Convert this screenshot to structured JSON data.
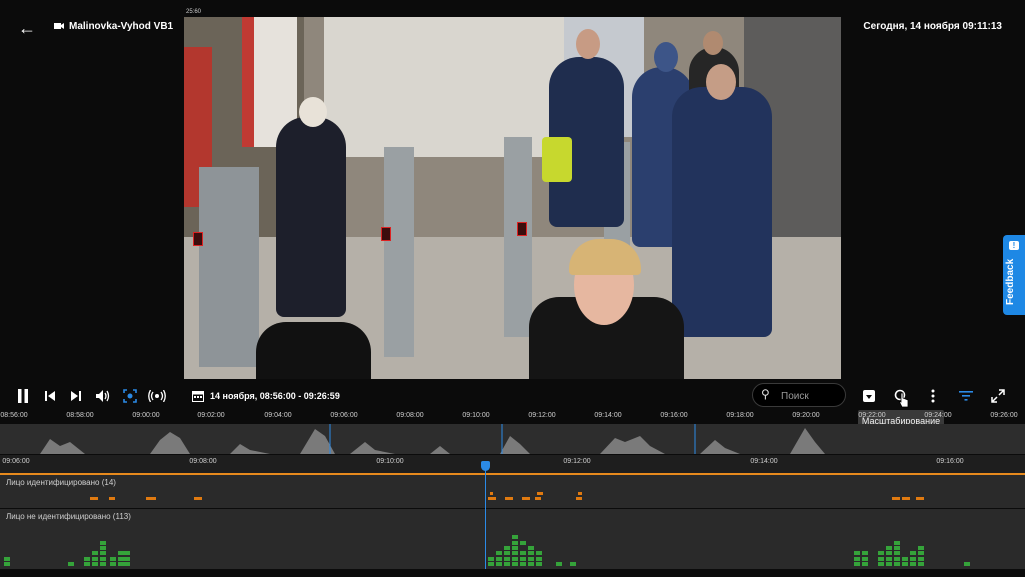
{
  "header": {
    "camera_name": "Malinovka-Vyhod VB1",
    "datetime": "Сегодня, 14 ноября 09:11:13",
    "small_ts": "25:60"
  },
  "video": {
    "alt": "camera feed"
  },
  "feedback": {
    "label": "Feedback",
    "icon_glyph": "!"
  },
  "toolbar": {
    "range_label": "14 ноября, 08:56:00 - 09:26:59",
    "search_placeholder": "Поиск",
    "tooltip": "Масштабирование",
    "icons": {
      "pause": "⏸",
      "prev": "⏮",
      "next": "⏭",
      "volume": "🔊",
      "fullscreen_box": "⛶",
      "broadcast": "((•))",
      "calendar": "▦",
      "search": "⌕",
      "download": "⬇",
      "zoom": "⊕",
      "more": "⋮",
      "filter": "≡",
      "expand": "⤢"
    },
    "accent_color": "#2b8ae6"
  },
  "timeline": {
    "top_ruler": [
      "08:56:00",
      "08:58:00",
      "09:00:00",
      "09:02:00",
      "09:04:00",
      "09:06:00",
      "09:08:00",
      "09:10:00",
      "09:12:00",
      "09:14:00",
      "09:16:00",
      "09:18:00",
      "09:20:00",
      "09:22:00",
      "09:24:00",
      "09:26:00"
    ],
    "bottom_ruler": [
      "09:06:00",
      "09:08:00",
      "09:10:00",
      "09:12:00",
      "09:14:00",
      "09:16:00"
    ],
    "track_identified": {
      "label": "Лицо идентифицировано (14)",
      "color": "#e07a10"
    },
    "track_unidentified": {
      "label": "Лицо не идентифицировано (113)",
      "color": "#35a33a"
    },
    "line_color": "#e78a1d"
  }
}
